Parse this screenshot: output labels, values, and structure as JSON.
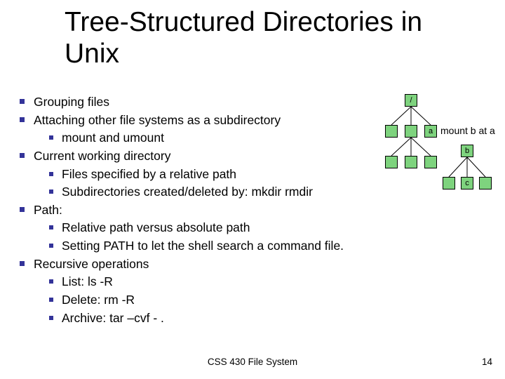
{
  "title": "Tree-Structured Directories in Unix",
  "bullets": {
    "b0": "Grouping files",
    "b1": "Attaching other file systems as a subdirectory",
    "b1_0": "mount and umount",
    "b2": "Current working directory",
    "b2_0": "Files specified by a relative path",
    "b2_1": "Subdirectories created/deleted by: mkdir rmdir",
    "b3": "Path:",
    "b3_0": "Relative path versus absolute path",
    "b3_1": "Setting PATH to let the shell search a command file.",
    "b4": "Recursive operations",
    "b4_0": "List: ls -R",
    "b4_1": "Delete: rm -R",
    "b4_2": "Archive: tar –cvf - ."
  },
  "tree": {
    "root": "/",
    "a": "a",
    "b": "b",
    "c": "c",
    "mount_label": "mount b at a"
  },
  "footer": {
    "center": "CSS 430 File System",
    "page": "14"
  }
}
